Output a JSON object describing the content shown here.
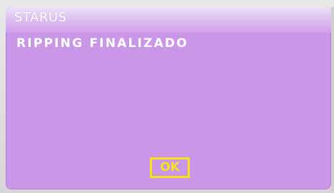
{
  "dialog": {
    "title": "STARUS",
    "message": "RIPPING FINALIZADO",
    "ok_label": "OK"
  },
  "colors": {
    "dialog_background": "#c996e8",
    "button_accent": "#f5e21a",
    "text": "#ffffff"
  }
}
